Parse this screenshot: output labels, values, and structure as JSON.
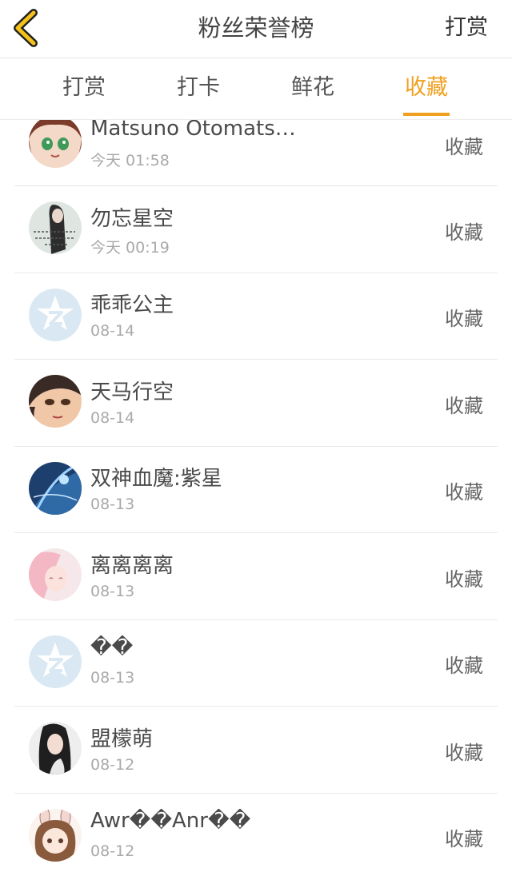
{
  "header": {
    "title": "粉丝荣誉榜",
    "right_link": "打赏",
    "accent": "#f0a020"
  },
  "tabs": [
    {
      "label": "打赏",
      "active": false
    },
    {
      "label": "打卡",
      "active": false
    },
    {
      "label": "鲜花",
      "active": false
    },
    {
      "label": "收藏",
      "active": true
    }
  ],
  "list": {
    "items": [
      {
        "name": "Matsuno Otomats…",
        "time": "今天 01:58",
        "action": "收藏",
        "avatar": "anime-girl-green-eyes"
      },
      {
        "name": "勿忘星空",
        "time": "今天 00:19",
        "action": "收藏",
        "avatar": "photo-girl-with-text"
      },
      {
        "name": "乖乖公主",
        "time": "08-14",
        "action": "收藏",
        "avatar": "default-z-logo"
      },
      {
        "name": "天马行空",
        "time": "08-14",
        "action": "收藏",
        "avatar": "anime-girl-dark-hair"
      },
      {
        "name": "双神血魔:紫星",
        "time": "08-13",
        "action": "收藏",
        "avatar": "blue-fantasy"
      },
      {
        "name": "离离离离",
        "time": "08-13",
        "action": "收藏",
        "avatar": "pink-anime-girl"
      },
      {
        "name": "��",
        "time": "08-13",
        "action": "收藏",
        "avatar": "default-z-logo"
      },
      {
        "name": "盟檬萌",
        "time": "08-12",
        "action": "收藏",
        "avatar": "photo-girl-dark-hair"
      },
      {
        "name": "Awr��Anr��",
        "time": "08-12",
        "action": "收藏",
        "avatar": "chibi-bunny-girl"
      }
    ]
  }
}
